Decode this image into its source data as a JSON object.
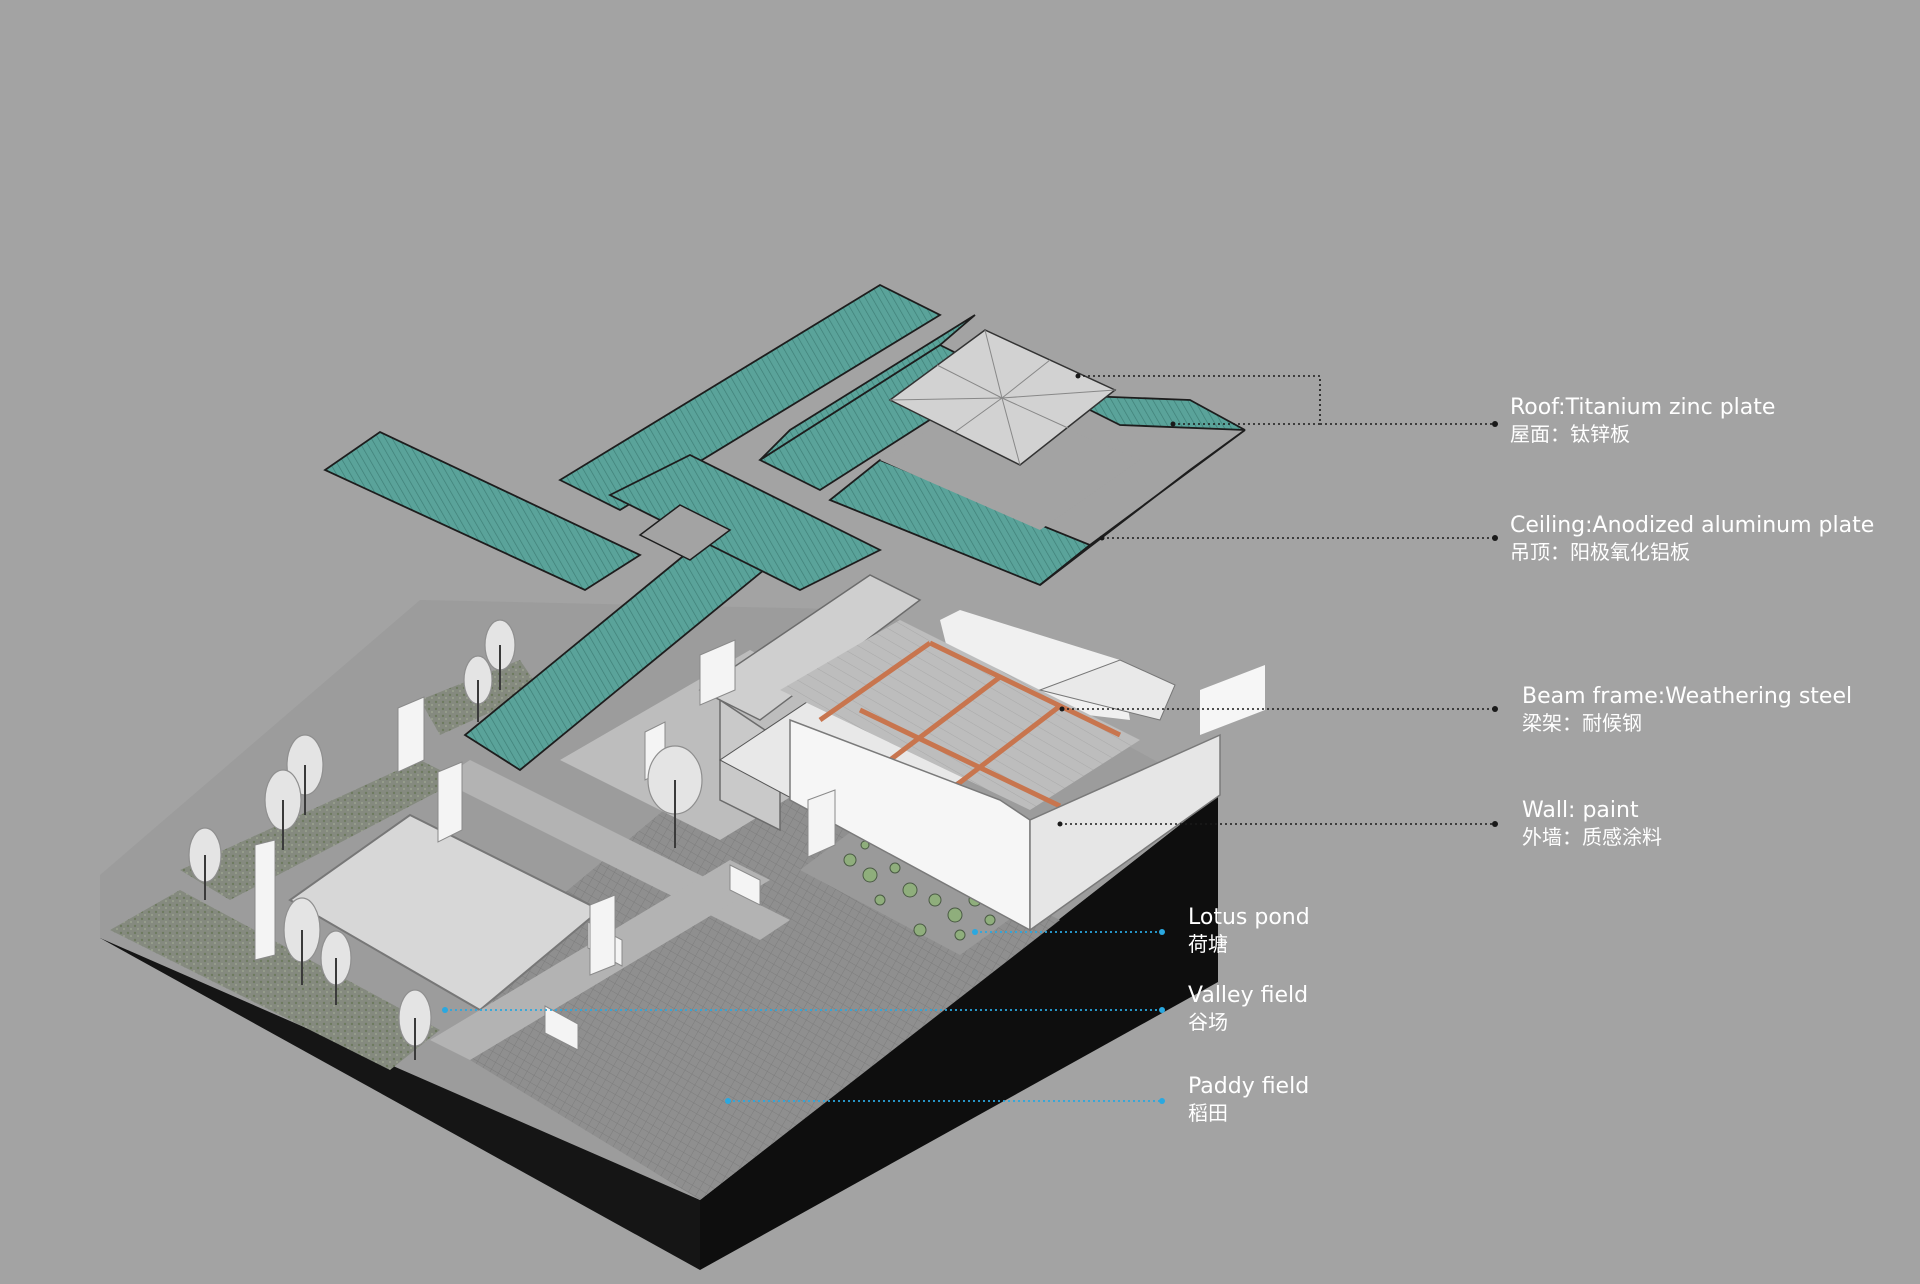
{
  "colors": {
    "background": "#a3a3a3",
    "roof": "#5aa39a",
    "roof_dark": "#3f7f77",
    "ground_block": "#111111",
    "wall": "#f2f2f2",
    "beam": "#c8754e",
    "leader_black": "#1a1a1a",
    "leader_blue": "#2aa8e0",
    "paving": "#8e8e8e",
    "grass": "#7f8a74"
  },
  "labels": {
    "roof": {
      "en": "Roof:Titanium zinc plate",
      "zh": "屋面：钛锌板"
    },
    "ceiling": {
      "en": "Ceiling:Anodized aluminum plate",
      "zh": "吊顶：阳极氧化铝板"
    },
    "beam": {
      "en": "Beam frame:Weathering steel",
      "zh": "梁架：耐候钢"
    },
    "wall": {
      "en": "Wall:  paint",
      "zh": "外墙：质感涂料"
    },
    "lotus": {
      "en": "Lotus pond",
      "zh": "荷塘"
    },
    "valley": {
      "en": "Valley field",
      "zh": "谷场"
    },
    "paddy": {
      "en": "Paddy field",
      "zh": "稻田"
    }
  }
}
